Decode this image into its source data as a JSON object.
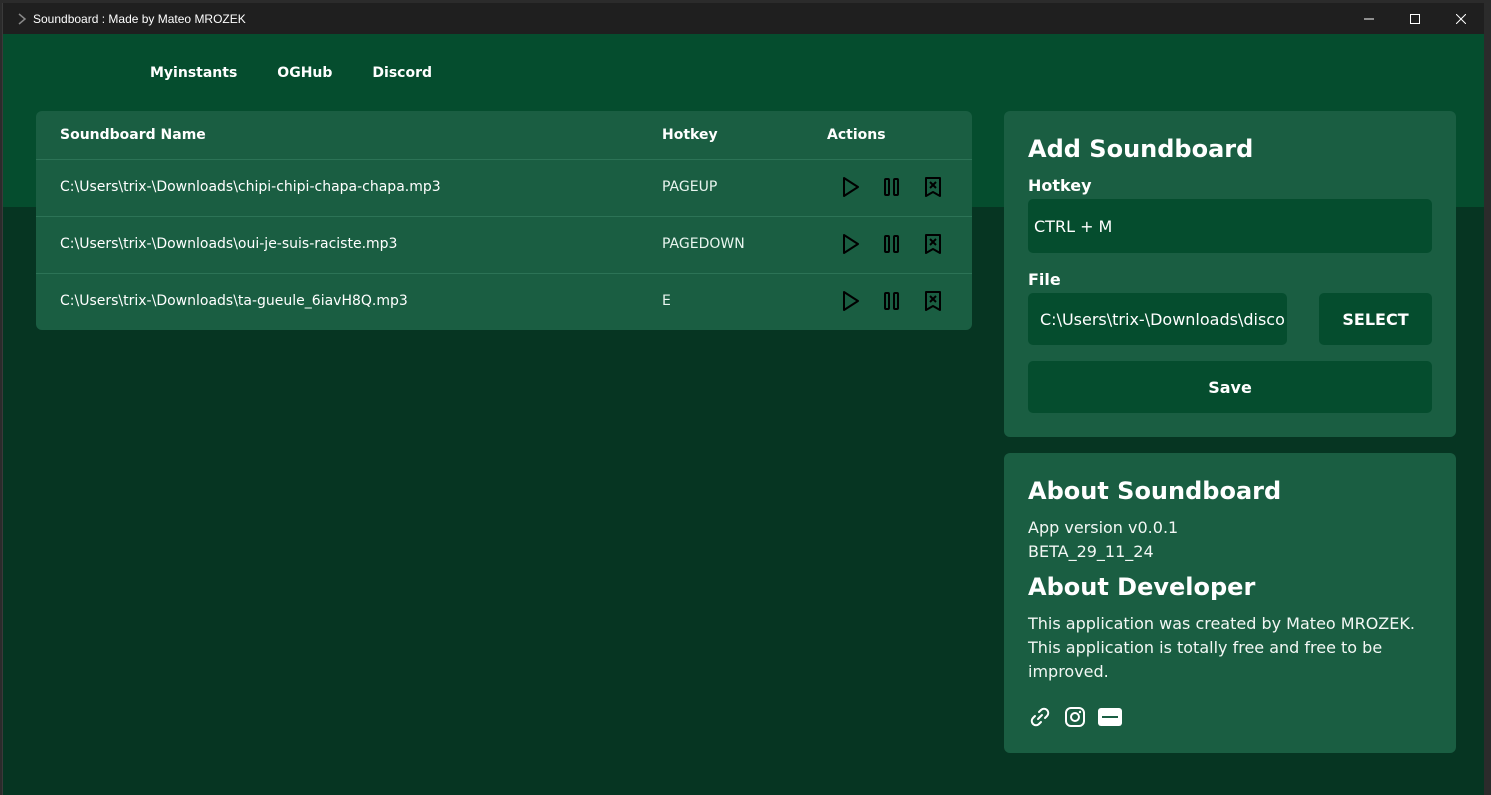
{
  "window": {
    "title": "Soundboard : Made by Mateo MROZEK"
  },
  "nav": [
    "Myinstants",
    "OGHub",
    "Discord"
  ],
  "table": {
    "headers": {
      "name": "Soundboard Name",
      "hotkey": "Hotkey",
      "actions": "Actions"
    },
    "rows": [
      {
        "name": "C:\\Users\\trix-\\Downloads\\chipi-chipi-chapa-chapa.mp3",
        "hotkey": "PAGEUP"
      },
      {
        "name": "C:\\Users\\trix-\\Downloads\\oui-je-suis-raciste.mp3",
        "hotkey": "PAGEDOWN"
      },
      {
        "name": "C:\\Users\\trix-\\Downloads\\ta-gueule_6iavH8Q.mp3",
        "hotkey": "E"
      }
    ]
  },
  "add": {
    "title": "Add Soundboard",
    "hotkey_label": "Hotkey",
    "hotkey_value": "CTRL + M",
    "file_label": "File",
    "file_value": "C:\\Users\\trix-\\Downloads\\disco",
    "select_label": "SELECT",
    "save_label": "Save"
  },
  "about": {
    "title": "About Soundboard",
    "version": "App version v0.0.1",
    "build": "BETA_29_11_24",
    "dev_title": "About Developer",
    "dev_line1": "This application was created by Mateo MROZEK.",
    "dev_line2": "This application is totally free and free to be",
    "dev_line3": "improved."
  },
  "icons": {
    "socials": [
      "link-icon",
      "instagram-icon",
      "stripe-icon"
    ],
    "row_actions": [
      "play-icon",
      "pause-icon",
      "delete-bookmark-icon"
    ]
  },
  "colors": {
    "bg_dark": "#063522",
    "band": "#054d2e",
    "card": "#1a5e42",
    "input": "#054d2e",
    "titlebar": "#1f1f1f"
  }
}
